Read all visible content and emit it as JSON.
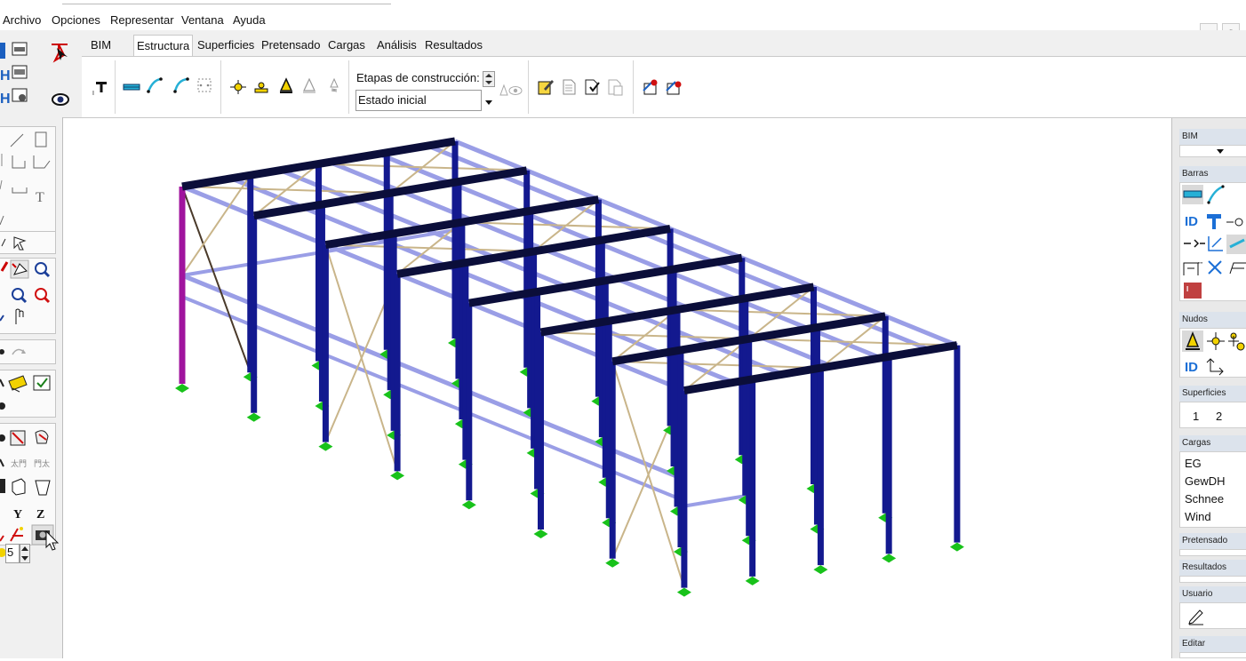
{
  "menu": {
    "items": [
      "Archivo",
      "Opciones",
      "Representar",
      "Ventana",
      "Ayuda"
    ]
  },
  "window_controls": {
    "minimize": "–",
    "restore": "▫"
  },
  "ribbon": {
    "tabs": [
      "BIM",
      "Estructura",
      "Superficies",
      "Pretensado",
      "Cargas",
      "Análisis",
      "Resultados"
    ],
    "active_tab": "Estructura",
    "construction_stages_label": "Etapas de construcción:",
    "construction_stage_value": "Estado inicial"
  },
  "left_toolbox": {
    "view_axes": [
      "Y",
      "Z"
    ],
    "spinner_value": "5"
  },
  "right_panel": {
    "bim": {
      "title": "BIM"
    },
    "barras": {
      "title": "Barras"
    },
    "nudos": {
      "title": "Nudos"
    },
    "superficies": {
      "title": "Superficies",
      "items": [
        "1",
        "2"
      ]
    },
    "cargas": {
      "title": "Cargas",
      "items": [
        "EG",
        "GewDH",
        "Schnee",
        "Wind"
      ]
    },
    "pretensado": {
      "title": "Pretensado"
    },
    "resultados": {
      "title": "Resultados"
    },
    "usuario": {
      "title": "Usuario"
    },
    "editar": {
      "title": "Editar"
    }
  },
  "colors": {
    "column_blue": "#13198f",
    "beam_navy": "#0b0e3a",
    "purlin_lavender": "#9a9ee6",
    "brace_tan": "#c9b58a",
    "brace_dark": "#4a3a2a",
    "support_green": "#18c21a",
    "accent_magenta": "#a0149e"
  }
}
